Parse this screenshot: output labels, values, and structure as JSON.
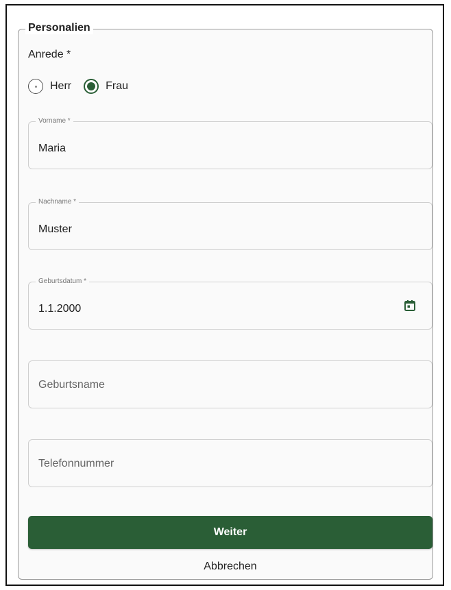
{
  "section": {
    "legend": "Personalien"
  },
  "anrede": {
    "label": "Anrede *",
    "options": [
      {
        "label": "Herr",
        "checked": false
      },
      {
        "label": "Frau",
        "checked": true
      }
    ]
  },
  "fields": {
    "vorname": {
      "label": "Vorname *",
      "value": "Maria"
    },
    "nachname": {
      "label": "Nachname *",
      "value": "Muster"
    },
    "geburtsdatum": {
      "label": "Geburtsdatum *",
      "value": "1.1.2000",
      "icon": "calendar-icon"
    },
    "geburtsname": {
      "placeholder": "Geburtsname"
    },
    "telefonnummer": {
      "placeholder": "Telefonnummer"
    }
  },
  "actions": {
    "submit_label": "Weiter",
    "cancel_label": "Abbrechen"
  },
  "colors": {
    "accent": "#2a5e36",
    "border": "#cfcfcf",
    "background": "#fafafa"
  }
}
